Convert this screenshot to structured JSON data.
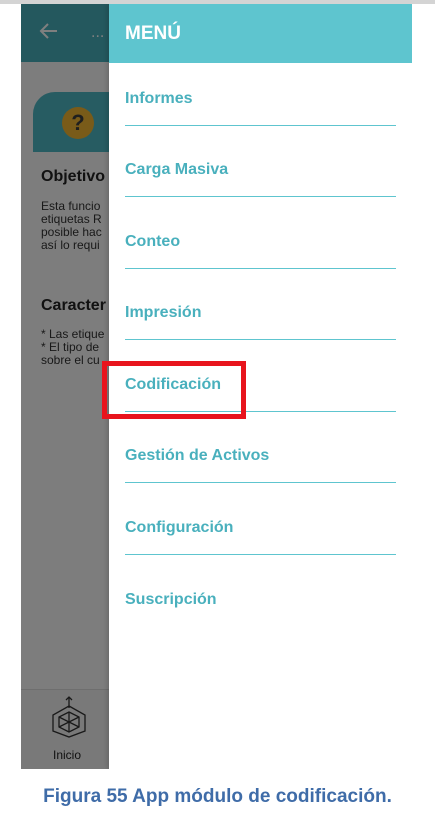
{
  "background_app": {
    "header_dots": "...",
    "help_icon": "?",
    "objective_title": "Objetivo",
    "objective_lines": [
      "Esta funcio",
      "etiquetas R",
      "posible hac",
      "así lo requi"
    ],
    "features_title": "Caracter",
    "features_lines": [
      "* Las etique",
      "* El tipo de",
      "sobre el cu"
    ],
    "bottom_nav_label": "Inicio"
  },
  "menu": {
    "title": "MENÚ",
    "items": [
      {
        "label": "Informes"
      },
      {
        "label": "Carga Masiva"
      },
      {
        "label": "Conteo"
      },
      {
        "label": "Impresión"
      },
      {
        "label": "Codificación"
      },
      {
        "label": "Gestión de Activos"
      },
      {
        "label": "Configuración"
      },
      {
        "label": "Suscripción"
      }
    ],
    "highlighted_item": "Codificación"
  },
  "caption": "Figura 55 App módulo de codificación.",
  "colors": {
    "header_teal": "#5ec5cf",
    "menu_text": "#49b0bd",
    "highlight_red": "#e8141d",
    "caption_blue": "#3f6ca8"
  }
}
